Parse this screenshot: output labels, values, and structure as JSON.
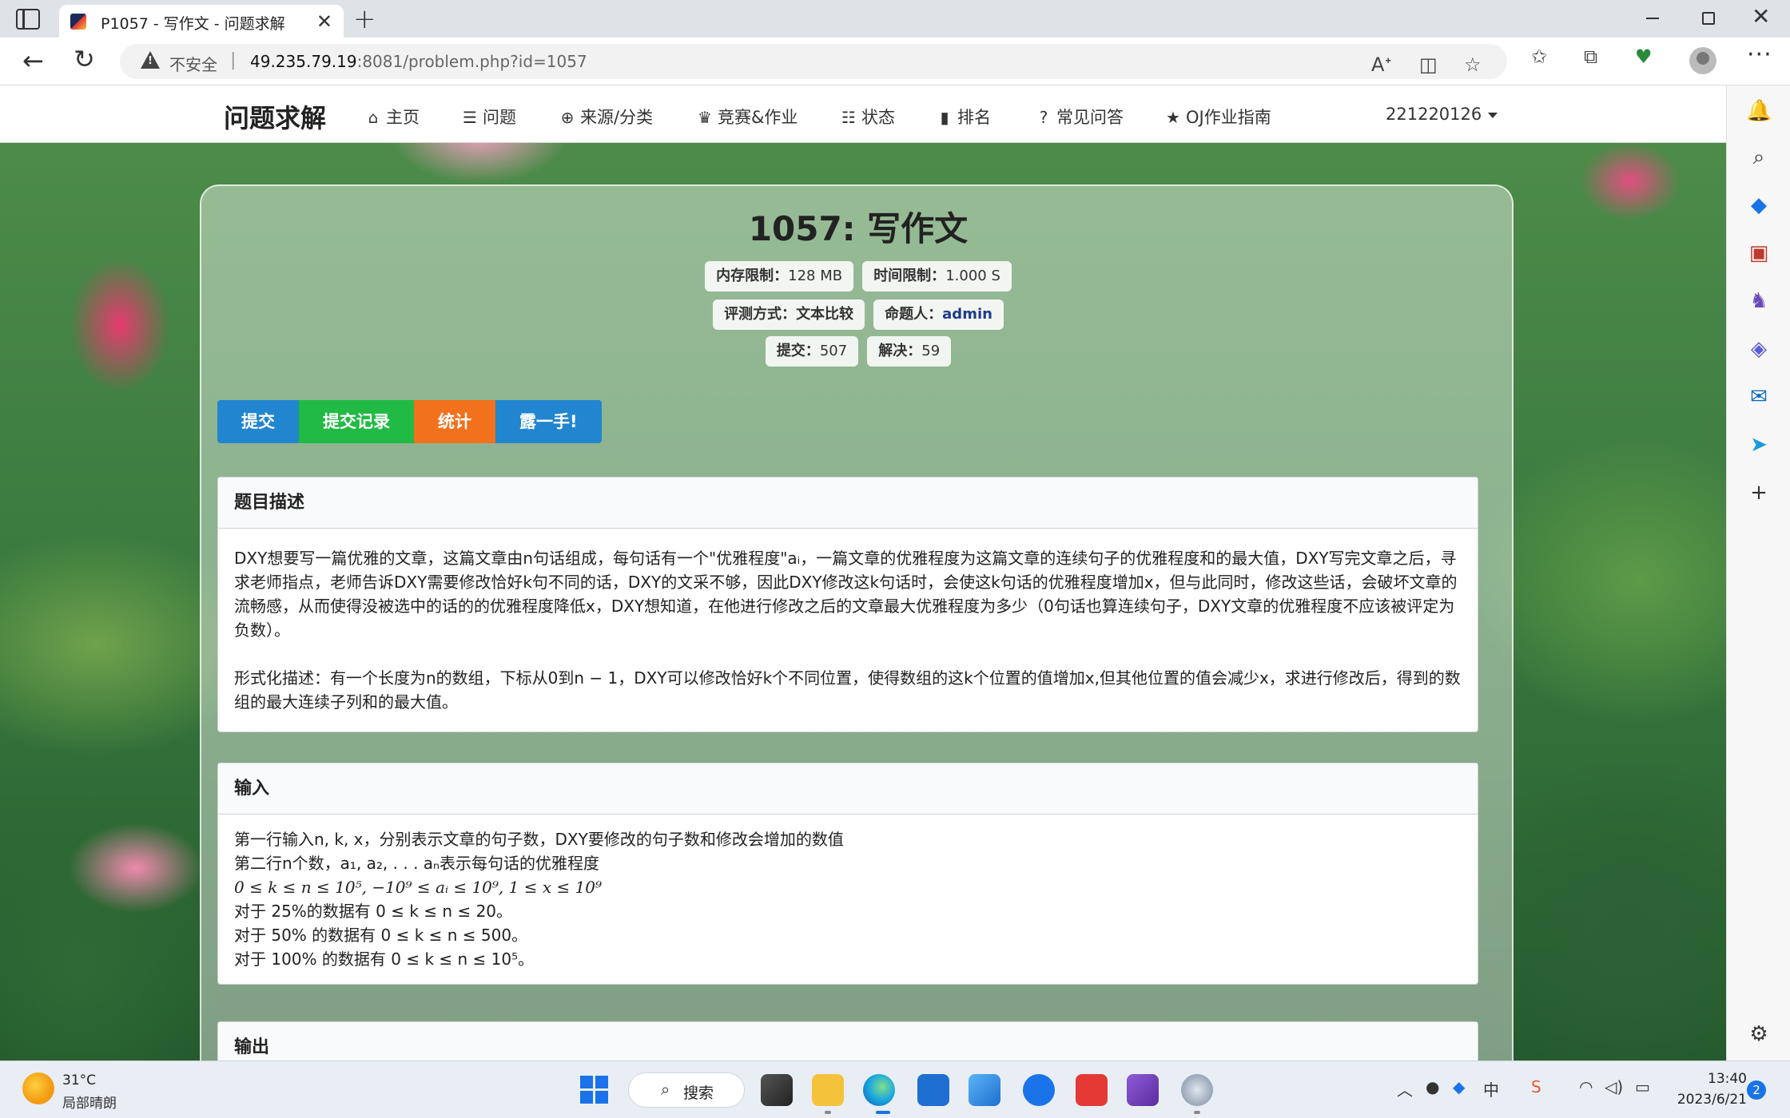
{
  "browser": {
    "tab_title": "P1057 - 写作文 - 问题求解",
    "insecure_label": "不安全",
    "url_host": "49.235.79.19",
    "url_rest": ":8081/problem.php?id=1057"
  },
  "site": {
    "brand": "问题求解",
    "nav": [
      {
        "label": "主页",
        "icon": "home-icon"
      },
      {
        "label": "问题",
        "icon": "list-icon"
      },
      {
        "label": "来源/分类",
        "icon": "globe-icon"
      },
      {
        "label": "竞赛&作业",
        "icon": "trophy-icon"
      },
      {
        "label": "状态",
        "icon": "tasks-icon"
      },
      {
        "label": "排名",
        "icon": "bar-chart-icon"
      },
      {
        "label": "常见问答",
        "icon": "question-circle-icon"
      },
      {
        "label": "OJ作业指南",
        "icon": "star-icon"
      }
    ],
    "user": "221220126"
  },
  "problem": {
    "title": "1057: 写作文",
    "memory_label": "内存限制：",
    "memory_value": "128 MB",
    "time_label": "时间限制：",
    "time_value": "1.000 S",
    "judge_label": "评测方式：",
    "judge_value": "文本比较",
    "author_label": "命题人：",
    "author_value": "admin",
    "submit_label": "提交：",
    "submit_value": "507",
    "solved_label": "解决：",
    "solved_value": "59"
  },
  "actions": {
    "submit": "提交",
    "records": "提交记录",
    "stats": "统计",
    "show": "露一手!"
  },
  "sections": {
    "description_header": "题目描述",
    "description_p1": "DXY想要写一篇优雅的文章，这篇文章由n句话组成，每句话有一个\"优雅程度\"aᵢ，一篇文章的优雅程度为这篇文章的连续句子的优雅程度和的最大值，DXY写完文章之后，寻求老师指点，老师告诉DXY需要修改恰好k句不同的话，DXY的文采不够，因此DXY修改这k句话时，会使这k句话的优雅程度增加x，但与此同时，修改这些话，会破坏文章的流畅感，从而使得没被选中的话的的优雅程度降低x，DXY想知道，在他进行修改之后的文章最大优雅程度为多少（0句话也算连续句子，DXY文章的优雅程度不应该被评定为负数）。",
    "description_p2": "形式化描述：有一个长度为n的数组，下标从0到n − 1，DXY可以修改恰好k个不同位置，使得数组的这k个位置的值增加x,但其他位置的值会减少x，求进行修改后，得到的数组的最大连续子列和的最大值。",
    "input_header": "输入",
    "input_lines": [
      "第一行输入n, k, x，分别表示文章的句子数，DXY要修改的句子数和修改会增加的数值",
      "第二行n个数，a₁, a₂, . . . aₙ表示每句话的优雅程度",
      "0 ≤ k ≤ n ≤ 10⁵, −10⁹ ≤ aᵢ ≤ 10⁹, 1 ≤ x ≤ 10⁹",
      "对于 25%的数据有 0 ≤ k ≤ n ≤ 20。",
      "对于 50% 的数据有 0 ≤ k ≤ n ≤ 500。",
      "对于 100% 的数据有 0 ≤ k ≤ n ≤ 10⁵。"
    ],
    "output_header": "输出"
  },
  "taskbar": {
    "temp": "31°C",
    "weather": "局部晴朗",
    "search": "搜索",
    "time": "13:40",
    "date": "2023/6/21",
    "notifications": "2",
    "ime": "中"
  }
}
